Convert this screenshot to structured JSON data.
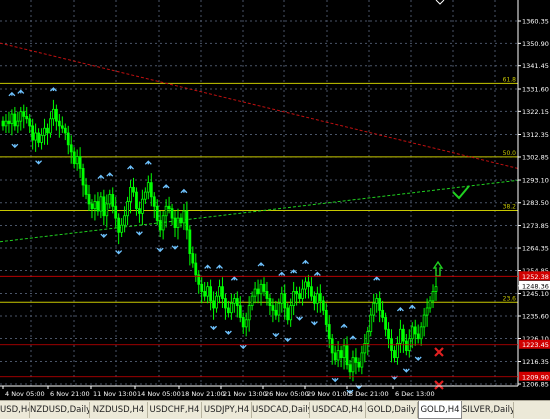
{
  "chart_data": {
    "type": "candlestick",
    "symbol": "GOLD,H4",
    "y_axis_labels": [
      "1360.35",
      "1350.90",
      "1341.45",
      "1331.60",
      "1322.15",
      "1312.35",
      "1302.85",
      "1293.10",
      "1283.50",
      "1273.85",
      "1264.35",
      "1254.85",
      "1248.36",
      "1245.10",
      "1235.60",
      "1226.10",
      "1216.35",
      "1206.85"
    ],
    "price_tags": {
      "red_top": "1252.38",
      "current": "1248.36",
      "red_mid": "1223.45",
      "red_bottom": "1209.90"
    },
    "x_axis_labels": [
      "4 Nov 05:00",
      "6 Nov 21:00",
      "11 Nov 13:00",
      "14 Nov 05:00",
      "18 Nov 21:00",
      "21 Nov 13:00",
      "26 Nov 05:00",
      "29 Nov 01:00",
      "3 Dec 21:00",
      "6 Dec 13:00"
    ],
    "fib_levels": [
      {
        "label": "61.8",
        "price": 1334.0
      },
      {
        "label": "50.0",
        "price": 1302.9
      },
      {
        "label": "38.2",
        "price": 1280.2
      },
      {
        "label": "23.6",
        "price": 1241.4
      }
    ],
    "close_series": [
      1316,
      1318,
      1317,
      1321,
      1316,
      1318,
      1322,
      1320,
      1319,
      1316,
      1310,
      1313,
      1309,
      1312,
      1315,
      1313,
      1319,
      1323,
      1318,
      1316,
      1315,
      1313,
      1308,
      1305,
      1300,
      1303,
      1298,
      1291,
      1287,
      1283,
      1281,
      1284,
      1280,
      1286,
      1278,
      1283,
      1287,
      1282,
      1277,
      1271,
      1274,
      1278,
      1284,
      1290,
      1288,
      1281,
      1279,
      1285,
      1288,
      1292,
      1286,
      1282,
      1276,
      1272,
      1278,
      1282,
      1281,
      1277,
      1273,
      1277,
      1275,
      1280,
      1272,
      1262,
      1258,
      1253,
      1249,
      1246,
      1244,
      1248,
      1242,
      1239,
      1244,
      1248,
      1243,
      1239,
      1237,
      1241,
      1243,
      1240,
      1235,
      1231,
      1234,
      1240,
      1244,
      1247,
      1245,
      1249,
      1246,
      1243,
      1240,
      1238,
      1236,
      1241,
      1245,
      1239,
      1234,
      1240,
      1246,
      1245,
      1243,
      1247,
      1250,
      1248,
      1244,
      1241,
      1245,
      1242,
      1238,
      1232,
      1226,
      1220,
      1217,
      1221,
      1218,
      1223,
      1215,
      1212,
      1218,
      1216,
      1214,
      1220,
      1224,
      1229,
      1236,
      1241,
      1243,
      1238,
      1235,
      1230,
      1226,
      1221,
      1218,
      1224,
      1230,
      1225,
      1221,
      1226,
      1231,
      1228,
      1226,
      1231,
      1236,
      1239,
      1242,
      1246,
      1248
    ]
  },
  "tabs": [
    {
      "label": "USD,H4"
    },
    {
      "label": "NZDUSD,Daily"
    },
    {
      "label": "NZDUSD,H4"
    },
    {
      "label": "USDCHF,H4"
    },
    {
      "label": "USDJPY,H4"
    },
    {
      "label": "USDCAD,Daily"
    },
    {
      "label": "USDCAD,H4"
    },
    {
      "label": "GOLD,Daily"
    },
    {
      "label": "GOLD,H4"
    },
    {
      "label": "SILVER,Daily"
    }
  ],
  "colors": {
    "background": "#000000",
    "candle": "#00ff00",
    "grid": "#4a5568",
    "fib": "#c8c800",
    "trend_red": "#c01010",
    "trend_green": "#20d020",
    "arrow": "#6fc3ff",
    "tag_red": "#d10000",
    "axis_text": "#ffffff"
  }
}
